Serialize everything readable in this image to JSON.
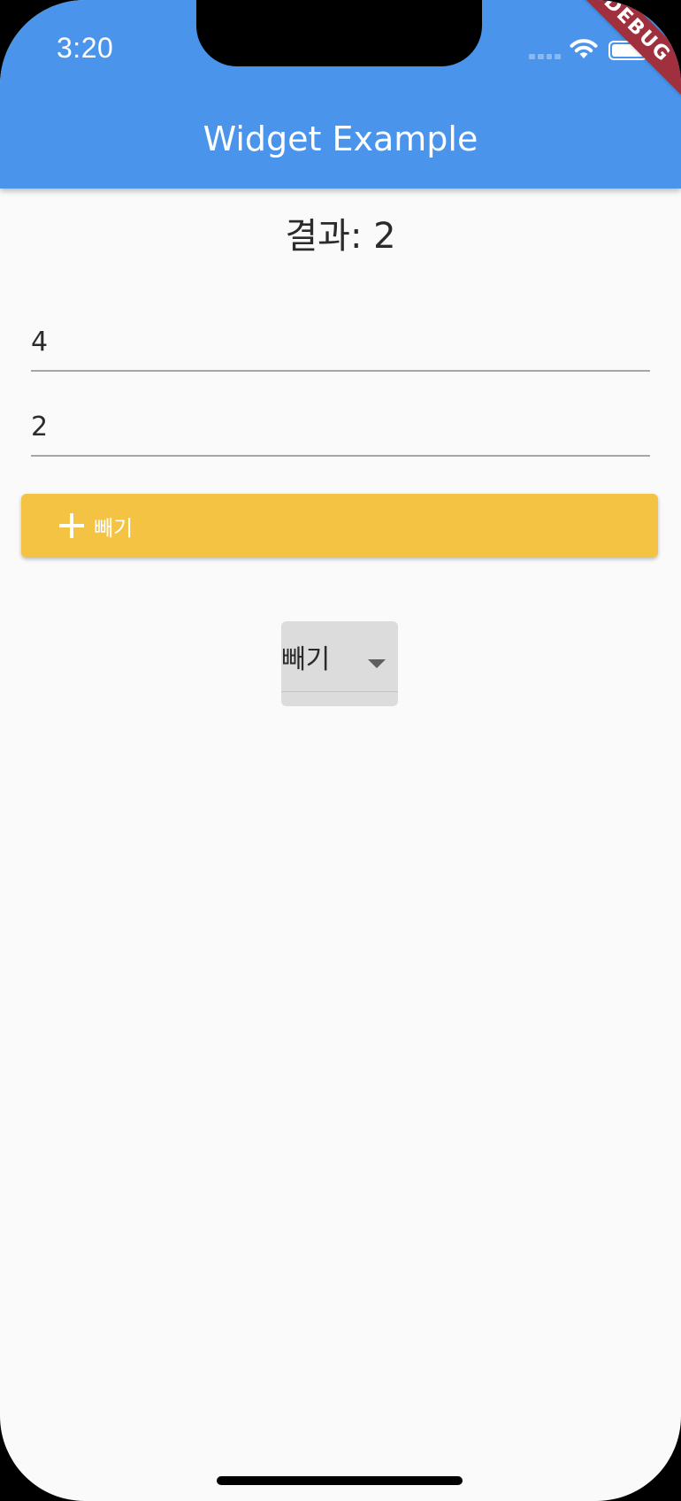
{
  "status_bar": {
    "time": "3:20"
  },
  "app_bar": {
    "title": "Widget Example",
    "background_color": "#4a94eb"
  },
  "debug_banner": {
    "label": "DEBUG"
  },
  "result": {
    "text": "결과: 2"
  },
  "inputs": {
    "first_value": "4",
    "second_value": "2"
  },
  "action_button": {
    "icon": "plus-icon",
    "label": "빼기",
    "color": "#f5c344"
  },
  "operation_dropdown": {
    "selected": "빼기"
  }
}
